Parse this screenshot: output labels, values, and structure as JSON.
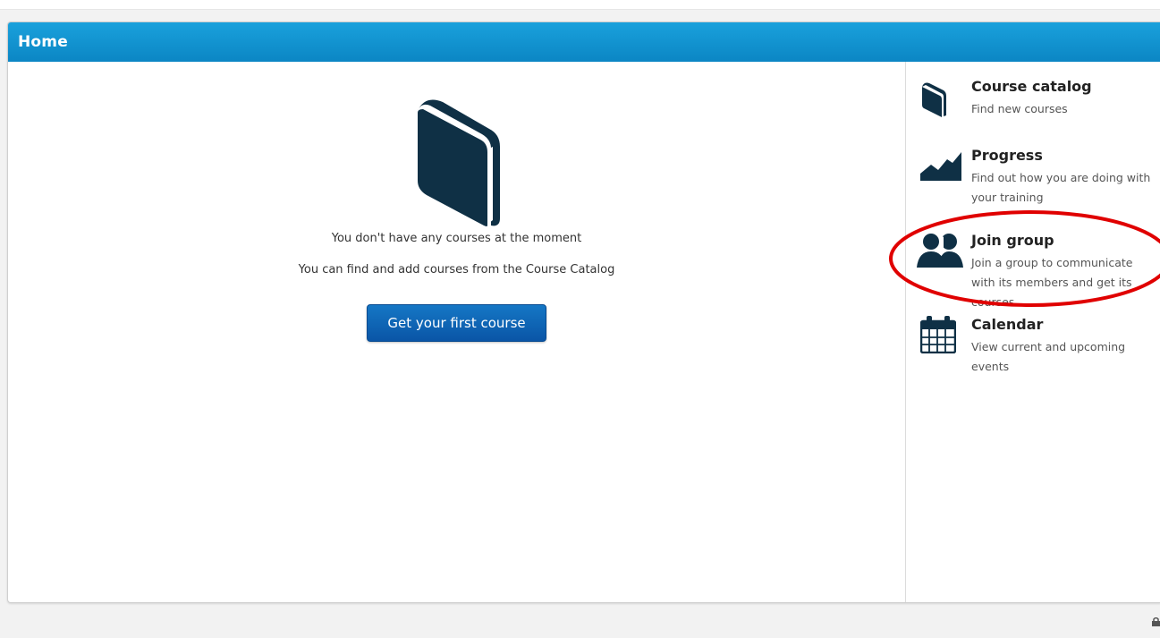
{
  "header": {
    "title": "Home"
  },
  "main": {
    "empty_message": "You don't have any courses at the moment",
    "hint": "You can find and add courses from the Course Catalog",
    "cta_label": "Get your first course"
  },
  "sidebar": {
    "items": [
      {
        "title": "Course catalog",
        "description": "Find new courses",
        "icon": "book-icon"
      },
      {
        "title": "Progress",
        "description": "Find out how you are doing with your training",
        "icon": "chart-icon"
      },
      {
        "title": "Join group",
        "description": "Join a group to communicate with its members and get its courses",
        "icon": "users-icon"
      },
      {
        "title": "Calendar",
        "description": "View current and upcoming events",
        "icon": "calendar-icon"
      }
    ]
  },
  "colors": {
    "header": "#1aa1dc",
    "button": "#1577c5",
    "icon": "#0f3045",
    "annotation": "#e00000"
  }
}
